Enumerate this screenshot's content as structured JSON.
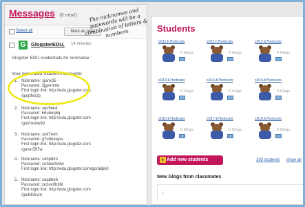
{
  "messages": {
    "title": "Messages",
    "new_count": "(6 new!)",
    "select_all": "Select all",
    "mark_button": "Mark as read",
    "sender": "GlogsterEDU,",
    "sent_time": "14 minutes",
    "intro": "Glogster EDU credentials for nickname :",
    "generated": "Your generated Student's accounts:",
    "accounts": [
      {
        "num": "1.",
        "nickname": "Nickname: sjanx35",
        "password": "Password: 3jgwmhte",
        "login": "First login link: http://edu.glogster.com",
        "path": "/go/pfke2p"
      },
      {
        "num": "2.",
        "nickname": "Nickname: sqv9ek4",
        "password": "Password: 6dubnq6q",
        "login": "First login link: http://edu.glogster.com",
        "path": "/go/mxmw9d"
      },
      {
        "num": "3.",
        "nickname": "Nickname: sok7eoh",
        "password": "Password: g7u9newpu",
        "login": "First login link: http://edu.glogster.com",
        "path": "/go/vn597w"
      },
      {
        "num": "4.",
        "nickname": "Nickname: s4hptbm",
        "password": "Password: 1efaxe4x9w",
        "login": "First login link: http://edu.glogster.com/go/atipk0",
        "path": ""
      },
      {
        "num": "5.",
        "nickname": "Nickname: saabbe6",
        "password": "Password: ze2ov0b36l",
        "login": "First login link: http://edu.glogster.com",
        "path": "/go/b63rvm"
      }
    ]
  },
  "callout": {
    "text": "The nicknames and passwords will be a combination of letters & numbers."
  },
  "students": {
    "title": "Students",
    "cards": [
      {
        "name": "s011.b7bobcats",
        "glogs": "0 Glogs"
      },
      {
        "name": "s011.b7bobcats",
        "glogs": "0 Glogs"
      },
      {
        "name": "s012.b7bobcats",
        "glogs": "0 Glogs"
      },
      {
        "name": "s013.b7bobcats",
        "glogs": "0 Glogs"
      },
      {
        "name": "s014.b7bobcats",
        "glogs": "0 Glogs"
      },
      {
        "name": "s015.b7bobcats",
        "glogs": "0 Glogs"
      },
      {
        "name": "s016.b7bobcats",
        "glogs": "0 Glogs"
      },
      {
        "name": "s017.b7bobcats",
        "glogs": "0 Glogs"
      },
      {
        "name": "s018.b7bobcats",
        "glogs": "0 Glogs"
      }
    ],
    "add_button": "Add new students",
    "count_link": "193 students",
    "show_all": "show all",
    "new_glogs_title": "New Glogs from classmates",
    "prev_arrow": "‹"
  }
}
